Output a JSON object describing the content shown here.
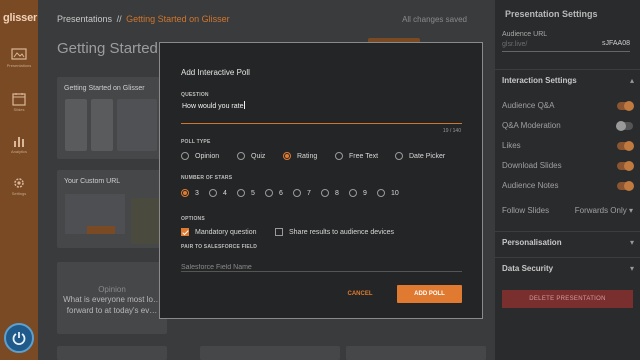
{
  "app": {
    "logo": "glisser"
  },
  "rail": {
    "items": [
      {
        "label": "Presentations",
        "icon": "presentation-icon"
      },
      {
        "label": "Slides",
        "icon": "calendar-icon"
      },
      {
        "label": "Analytics",
        "icon": "bar-chart-icon"
      },
      {
        "label": "Settings",
        "icon": "gear-icon"
      }
    ]
  },
  "header": {
    "breadcrumb_root": "Presentations",
    "breadcrumb_sep": "//",
    "breadcrumb_current": "Getting Started on Glisser",
    "save_status": "All changes saved"
  },
  "main": {
    "title": "Getting Started o",
    "slides": [
      {
        "label": "Getting Started on Glisser"
      },
      {
        "label": "Your Custom URL"
      },
      {
        "label": "Opinion",
        "question": "What is everyone most lo… forward to at today's ev…"
      }
    ]
  },
  "settings": {
    "title": "Presentation Settings",
    "audience_url_label": "Audience URL",
    "audience_url_prefix": "glsr.live/",
    "audience_url_value": "sJFAA08",
    "interaction_section": "Interaction Settings",
    "rows": [
      {
        "label": "Audience Q&A",
        "on": true
      },
      {
        "label": "Q&A Moderation",
        "on": false
      },
      {
        "label": "Likes",
        "on": true
      },
      {
        "label": "Download Slides",
        "on": true
      },
      {
        "label": "Audience Notes",
        "on": true
      }
    ],
    "follow_slides_label": "Follow Slides",
    "follow_slides_value": "Forwards Only",
    "personalisation_section": "Personalisation",
    "data_security_section": "Data Security",
    "delete_button": "DELETE PRESENTATION"
  },
  "modal": {
    "title": "Add Interactive Poll",
    "question_label": "QUESTION",
    "question_value": "How would you rate",
    "char_count": "19 / 140",
    "poll_type_label": "POLL TYPE",
    "poll_types": [
      "Opinion",
      "Quiz",
      "Rating",
      "Free Text",
      "Date Picker"
    ],
    "poll_type_selected": "Rating",
    "stars_label": "NUMBER OF STARS",
    "stars": [
      "3",
      "4",
      "5",
      "6",
      "7",
      "8",
      "9",
      "10"
    ],
    "stars_selected": "3",
    "options_label": "OPTIONS",
    "option_mandatory": "Mandatory question",
    "option_mandatory_checked": true,
    "option_share": "Share results to audience devices",
    "option_share_checked": false,
    "salesforce_label": "PAIR TO SALESFORCE FIELD",
    "salesforce_placeholder": "Salesforce Field Name",
    "cancel_label": "CANCEL",
    "add_label": "ADD POLL"
  },
  "colors": {
    "accent": "#e07a30",
    "danger": "#7a2f2f"
  }
}
